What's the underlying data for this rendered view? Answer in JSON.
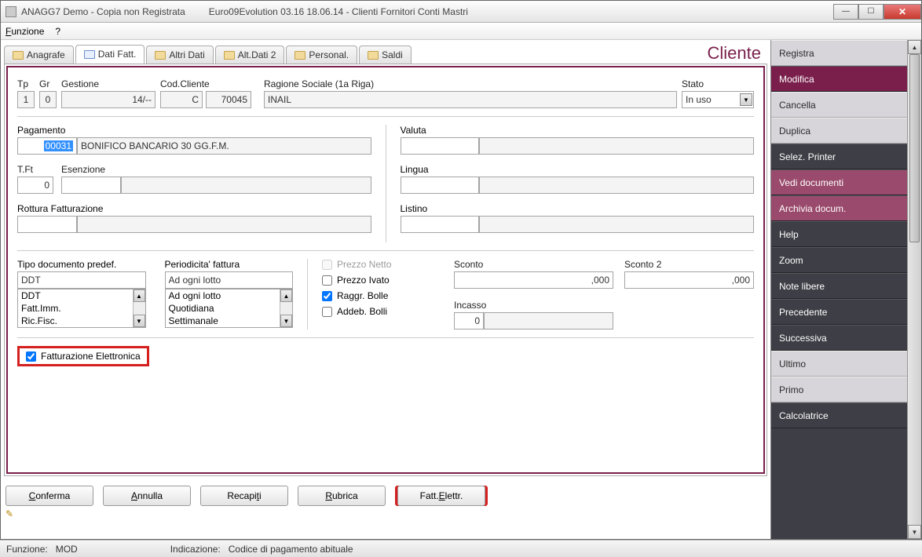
{
  "titlebar": {
    "left": "ANAGG7  Demo - Copia non Registrata",
    "right": "Euro09Evolution 03.16 18.06.14 - Clienti Fornitori Conti Mastri"
  },
  "menu": {
    "funzione": "Funzione",
    "help": "?"
  },
  "tabs": {
    "anagrafe": "Anagrafe",
    "dati_fatt": "Dati Fatt.",
    "altri_dati": "Altri Dati",
    "alt_dati2": "Alt.Dati 2",
    "personal": "Personal.",
    "saldi": "Saldi",
    "cliente_label": "Cliente"
  },
  "head": {
    "tp_label": "Tp",
    "gr_label": "Gr",
    "gestione_label": "Gestione",
    "cod_cliente_label": "Cod.Cliente",
    "ragione_label": "Ragione Sociale (1a Riga)",
    "stato_label": "Stato",
    "tp": "1",
    "gr": "0",
    "gestione": "14/--",
    "cod_prefix": "C",
    "cod_num": "70045",
    "ragione": "INAIL",
    "stato": "In uso"
  },
  "pagamento": {
    "label": "Pagamento",
    "code": "00031",
    "desc": "BONIFICO BANCARIO 30 GG.F.M."
  },
  "tft": {
    "label": "T.Ft",
    "val": "0"
  },
  "esenzione": {
    "label": "Esenzione",
    "code": "",
    "desc": ""
  },
  "rottura": {
    "label": "Rottura Fatturazione",
    "code": "",
    "desc": ""
  },
  "valuta": {
    "label": "Valuta",
    "code": "",
    "desc": ""
  },
  "lingua": {
    "label": "Lingua",
    "code": "",
    "desc": ""
  },
  "listino": {
    "label": "Listino",
    "code": "",
    "desc": ""
  },
  "tipo_doc": {
    "label": "Tipo documento predef.",
    "selected": "DDT",
    "options": [
      "DDT",
      "Fatt.Imm.",
      "Ric.Fisc."
    ]
  },
  "periodicita": {
    "label": "Periodicita' fattura",
    "selected": "Ad ogni lotto",
    "options": [
      "Ad ogni lotto",
      "Quotidiana",
      "Settimanale"
    ]
  },
  "checks": {
    "prezzo_netto": "Prezzo Netto",
    "prezzo_ivato": "Prezzo Ivato",
    "raggr_bolle": "Raggr. Bolle",
    "addeb_bolli": "Addeb. Bolli",
    "fatt_elettr": "Fatturazione Elettronica"
  },
  "sconti": {
    "sconto_label": "Sconto",
    "sconto2_label": "Sconto 2",
    "sconto": ",000",
    "sconto2": ",000",
    "incasso_label": "Incasso",
    "incasso": "0",
    "incasso_desc": ""
  },
  "buttons": {
    "conferma": "Conferma",
    "annulla": "Annulla",
    "recapiti": "Recapiti",
    "rubrica": "Rubrica",
    "fatt_elettr": "Fatt.Elettr."
  },
  "side": {
    "registra": "Registra",
    "modifica": "Modifica",
    "cancella": "Cancella",
    "duplica": "Duplica",
    "selez_printer": "Selez. Printer",
    "vedi_doc": "Vedi documenti",
    "archivia": "Archivia docum.",
    "help": "Help",
    "zoom": "Zoom",
    "note": "Note libere",
    "precedente": "Precedente",
    "successiva": "Successiva",
    "ultimo": "Ultimo",
    "primo": "Primo",
    "calcolatrice": "Calcolatrice"
  },
  "status": {
    "funzione_label": "Funzione:",
    "funzione_val": "MOD",
    "indicazione_label": "Indicazione:",
    "indicazione_val": "Codice di pagamento abituale"
  }
}
